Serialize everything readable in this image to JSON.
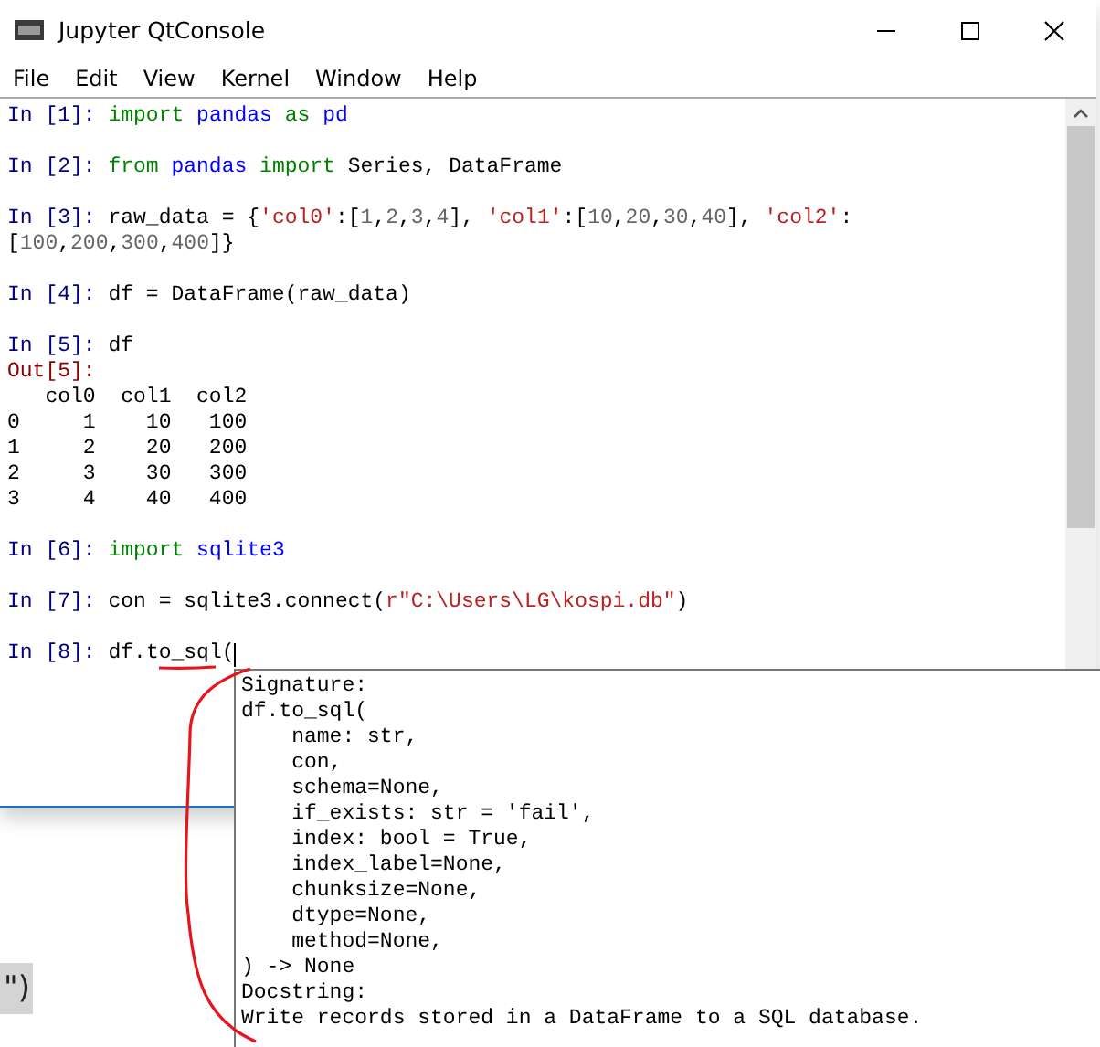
{
  "window": {
    "title": "Jupyter QtConsole"
  },
  "menu": [
    "File",
    "Edit",
    "View",
    "Kernel",
    "Window",
    "Help"
  ],
  "cells": [
    {
      "lines": [
        [
          {
            "kind": "prompt",
            "text": "In [1]: "
          },
          {
            "kind": "keyword",
            "text": "import"
          },
          {
            "kind": "name",
            "text": " pandas"
          },
          {
            "kind": "keyword",
            "text": " as"
          },
          {
            "kind": "name",
            "text": " pd"
          }
        ]
      ]
    },
    {
      "lines": [
        [
          {
            "kind": "prompt",
            "text": "In [2]: "
          },
          {
            "kind": "keyword",
            "text": "from"
          },
          {
            "kind": "name",
            "text": " pandas"
          },
          {
            "kind": "keyword",
            "text": " import"
          },
          {
            "kind": "text",
            "text": " Series, DataFrame"
          }
        ]
      ]
    },
    {
      "lines": [
        [
          {
            "kind": "prompt",
            "text": "In [3]: "
          },
          {
            "kind": "text",
            "text": "raw_data = {"
          },
          {
            "kind": "string",
            "text": "'col0'"
          },
          {
            "kind": "text",
            "text": ":["
          },
          {
            "kind": "number",
            "text": "1"
          },
          {
            "kind": "text",
            "text": ","
          },
          {
            "kind": "number",
            "text": "2"
          },
          {
            "kind": "text",
            "text": ","
          },
          {
            "kind": "number",
            "text": "3"
          },
          {
            "kind": "text",
            "text": ","
          },
          {
            "kind": "number",
            "text": "4"
          },
          {
            "kind": "text",
            "text": "], "
          },
          {
            "kind": "string",
            "text": "'col1'"
          },
          {
            "kind": "text",
            "text": ":["
          },
          {
            "kind": "number",
            "text": "10"
          },
          {
            "kind": "text",
            "text": ","
          },
          {
            "kind": "number",
            "text": "20"
          },
          {
            "kind": "text",
            "text": ","
          },
          {
            "kind": "number",
            "text": "30"
          },
          {
            "kind": "text",
            "text": ","
          },
          {
            "kind": "number",
            "text": "40"
          },
          {
            "kind": "text",
            "text": "], "
          },
          {
            "kind": "string",
            "text": "'col2'"
          },
          {
            "kind": "text",
            "text": ":"
          }
        ],
        [
          {
            "kind": "text",
            "text": "["
          },
          {
            "kind": "number",
            "text": "100"
          },
          {
            "kind": "text",
            "text": ","
          },
          {
            "kind": "number",
            "text": "200"
          },
          {
            "kind": "text",
            "text": ","
          },
          {
            "kind": "number",
            "text": "300"
          },
          {
            "kind": "text",
            "text": ","
          },
          {
            "kind": "number",
            "text": "400"
          },
          {
            "kind": "text",
            "text": "]}"
          }
        ]
      ]
    },
    {
      "lines": [
        [
          {
            "kind": "prompt",
            "text": "In [4]: "
          },
          {
            "kind": "text",
            "text": "df = DataFrame(raw_data)"
          }
        ]
      ]
    },
    {
      "lines": [
        [
          {
            "kind": "prompt",
            "text": "In [5]: "
          },
          {
            "kind": "text",
            "text": "df"
          }
        ],
        [
          {
            "kind": "out",
            "text": "Out[5]:"
          }
        ],
        [
          {
            "kind": "text",
            "text": "   col0  col1  col2"
          }
        ],
        [
          {
            "kind": "text",
            "text": "0     1    10   100"
          }
        ],
        [
          {
            "kind": "text",
            "text": "1     2    20   200"
          }
        ],
        [
          {
            "kind": "text",
            "text": "2     3    30   300"
          }
        ],
        [
          {
            "kind": "text",
            "text": "3     4    40   400"
          }
        ]
      ]
    },
    {
      "lines": [
        [
          {
            "kind": "prompt",
            "text": "In [6]: "
          },
          {
            "kind": "keyword",
            "text": "import"
          },
          {
            "kind": "name",
            "text": " sqlite3"
          }
        ]
      ]
    },
    {
      "lines": [
        [
          {
            "kind": "prompt",
            "text": "In [7]: "
          },
          {
            "kind": "text",
            "text": "con = sqlite3.connect("
          },
          {
            "kind": "string",
            "text": "r\"C:\\Users\\LG\\kospi.db\""
          },
          {
            "kind": "text",
            "text": ")"
          }
        ]
      ]
    },
    {
      "lines": [
        [
          {
            "kind": "prompt",
            "text": "In [8]: "
          },
          {
            "kind": "text",
            "text": "df."
          },
          {
            "kind": "text",
            "text": "to_sql"
          },
          {
            "kind": "text",
            "text": "("
          }
        ]
      ],
      "cursor": true
    }
  ],
  "tooltip": [
    "Signature:",
    "df.to_sql(",
    "    name: str,",
    "    con,",
    "    schema=None,",
    "    if_exists: str = 'fail',",
    "    index: bool = True,",
    "    index_label=None,",
    "    chunksize=None,",
    "    dtype=None,",
    "    method=None,",
    ") -> None",
    "Docstring:",
    "Write records stored in a DataFrame to a SQL database."
  ],
  "background_fragment": "\")"
}
